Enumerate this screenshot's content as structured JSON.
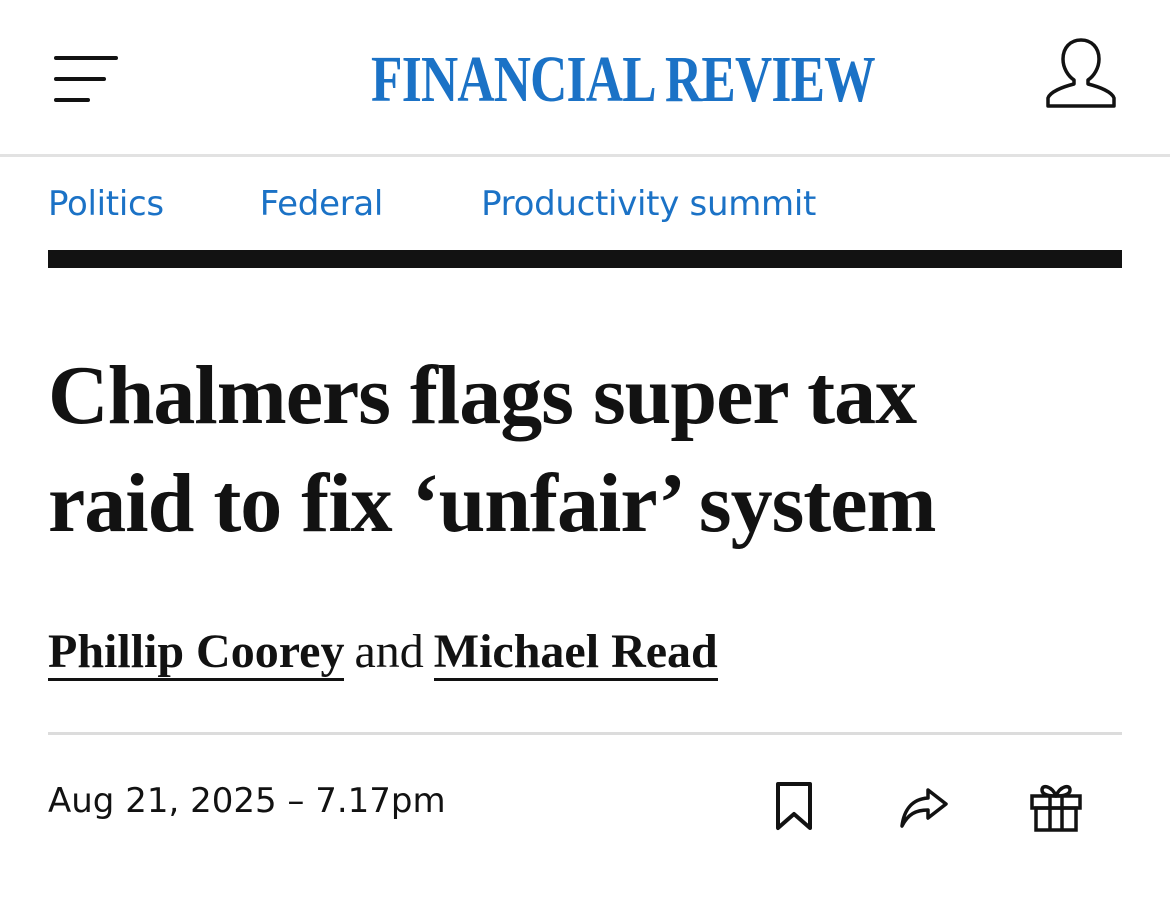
{
  "header": {
    "masthead": "FINANCIAL REVIEW",
    "brand_color": "#1b72c6",
    "menu_icon": "hamburger-menu-icon",
    "account_icon": "user-account-icon"
  },
  "breadcrumb": {
    "items": [
      {
        "label": "Politics"
      },
      {
        "label": "Federal"
      },
      {
        "label": "Productivity summit"
      }
    ]
  },
  "article": {
    "headline_line1": "Chalmers flags super tax",
    "headline_line2": "raid to fix ‘unfair’ system",
    "authors": [
      {
        "name": "Phillip Coorey"
      },
      {
        "name": "Michael Read"
      }
    ],
    "author_joiner": "and",
    "date": "Aug 21, 2025 – 7.17pm"
  },
  "actions": {
    "bookmark_icon": "bookmark-icon",
    "share_icon": "share-arrow-icon",
    "gift_icon": "gift-icon"
  }
}
